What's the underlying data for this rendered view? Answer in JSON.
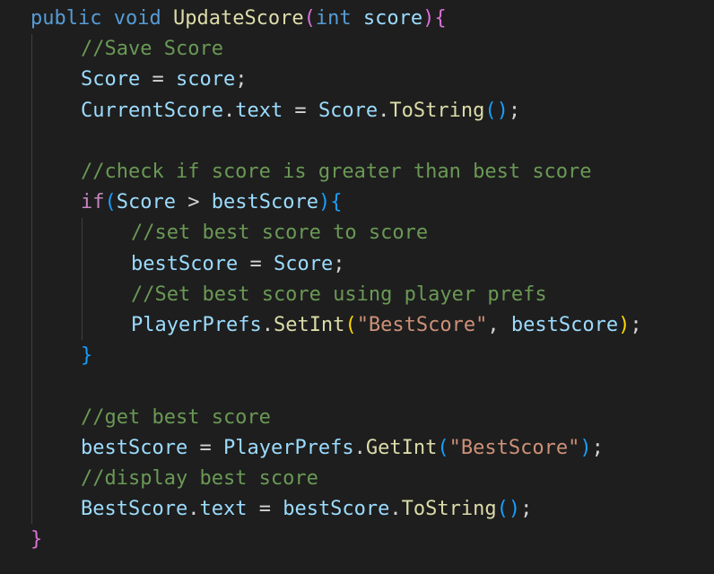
{
  "editor": {
    "background": "#1e1e1e",
    "lines": [
      {
        "indent": 0,
        "tokens": [
          {
            "t": "public",
            "c": "kw"
          },
          {
            "t": " ",
            "c": "op"
          },
          {
            "t": "void",
            "c": "kw"
          },
          {
            "t": " ",
            "c": "op"
          },
          {
            "t": "UpdateScore",
            "c": "fn"
          },
          {
            "t": "(",
            "c": "br2"
          },
          {
            "t": "int",
            "c": "kw"
          },
          {
            "t": " ",
            "c": "op"
          },
          {
            "t": "score",
            "c": "prm"
          },
          {
            "t": ")",
            "c": "br2"
          },
          {
            "t": "{",
            "c": "br2"
          }
        ]
      },
      {
        "indent": 1,
        "tokens": [
          {
            "t": "//Save Score",
            "c": "cmt"
          }
        ]
      },
      {
        "indent": 1,
        "tokens": [
          {
            "t": "Score",
            "c": "var"
          },
          {
            "t": " = ",
            "c": "op"
          },
          {
            "t": "score",
            "c": "prm"
          },
          {
            "t": ";",
            "c": "op"
          }
        ]
      },
      {
        "indent": 1,
        "tokens": [
          {
            "t": "CurrentScore",
            "c": "var"
          },
          {
            "t": ".",
            "c": "op"
          },
          {
            "t": "text",
            "c": "var"
          },
          {
            "t": " = ",
            "c": "op"
          },
          {
            "t": "Score",
            "c": "var"
          },
          {
            "t": ".",
            "c": "op"
          },
          {
            "t": "ToString",
            "c": "fn"
          },
          {
            "t": "()",
            "c": "br3"
          },
          {
            "t": ";",
            "c": "op"
          }
        ]
      },
      {
        "indent": 0,
        "tokens": []
      },
      {
        "indent": 1,
        "tokens": [
          {
            "t": "//check if score is greater than best score",
            "c": "cmt"
          }
        ]
      },
      {
        "indent": 1,
        "tokens": [
          {
            "t": "if",
            "c": "ctl"
          },
          {
            "t": "(",
            "c": "br3"
          },
          {
            "t": "Score",
            "c": "var"
          },
          {
            "t": " > ",
            "c": "op"
          },
          {
            "t": "bestScore",
            "c": "var"
          },
          {
            "t": ")",
            "c": "br3"
          },
          {
            "t": "{",
            "c": "br3"
          }
        ]
      },
      {
        "indent": 2,
        "tokens": [
          {
            "t": "//set best score to score",
            "c": "cmt"
          }
        ]
      },
      {
        "indent": 2,
        "tokens": [
          {
            "t": "bestScore",
            "c": "var"
          },
          {
            "t": " = ",
            "c": "op"
          },
          {
            "t": "Score",
            "c": "var"
          },
          {
            "t": ";",
            "c": "op"
          }
        ]
      },
      {
        "indent": 2,
        "tokens": [
          {
            "t": "//Set best score using player prefs",
            "c": "cmt"
          }
        ]
      },
      {
        "indent": 2,
        "tokens": [
          {
            "t": "PlayerPrefs",
            "c": "var"
          },
          {
            "t": ".",
            "c": "op"
          },
          {
            "t": "SetInt",
            "c": "fn"
          },
          {
            "t": "(",
            "c": "br1"
          },
          {
            "t": "\"BestScore\"",
            "c": "str"
          },
          {
            "t": ", ",
            "c": "op"
          },
          {
            "t": "bestScore",
            "c": "var"
          },
          {
            "t": ")",
            "c": "br1"
          },
          {
            "t": ";",
            "c": "op"
          }
        ]
      },
      {
        "indent": 1,
        "tokens": [
          {
            "t": "}",
            "c": "br3"
          }
        ]
      },
      {
        "indent": 0,
        "tokens": []
      },
      {
        "indent": 1,
        "tokens": [
          {
            "t": "//get best score",
            "c": "cmt"
          }
        ]
      },
      {
        "indent": 1,
        "tokens": [
          {
            "t": "bestScore",
            "c": "var"
          },
          {
            "t": " = ",
            "c": "op"
          },
          {
            "t": "PlayerPrefs",
            "c": "var"
          },
          {
            "t": ".",
            "c": "op"
          },
          {
            "t": "GetInt",
            "c": "fn"
          },
          {
            "t": "(",
            "c": "br3"
          },
          {
            "t": "\"BestScore\"",
            "c": "str"
          },
          {
            "t": ")",
            "c": "br3"
          },
          {
            "t": ";",
            "c": "op"
          }
        ]
      },
      {
        "indent": 1,
        "tokens": [
          {
            "t": "//display best score",
            "c": "cmt"
          }
        ]
      },
      {
        "indent": 1,
        "tokens": [
          {
            "t": "BestScore",
            "c": "var"
          },
          {
            "t": ".",
            "c": "op"
          },
          {
            "t": "text",
            "c": "var"
          },
          {
            "t": " = ",
            "c": "op"
          },
          {
            "t": "bestScore",
            "c": "var"
          },
          {
            "t": ".",
            "c": "op"
          },
          {
            "t": "ToString",
            "c": "fn"
          },
          {
            "t": "()",
            "c": "br3"
          },
          {
            "t": ";",
            "c": "op"
          }
        ]
      },
      {
        "indent": 0,
        "tokens": [
          {
            "t": "}",
            "c": "br2"
          }
        ]
      }
    ]
  }
}
